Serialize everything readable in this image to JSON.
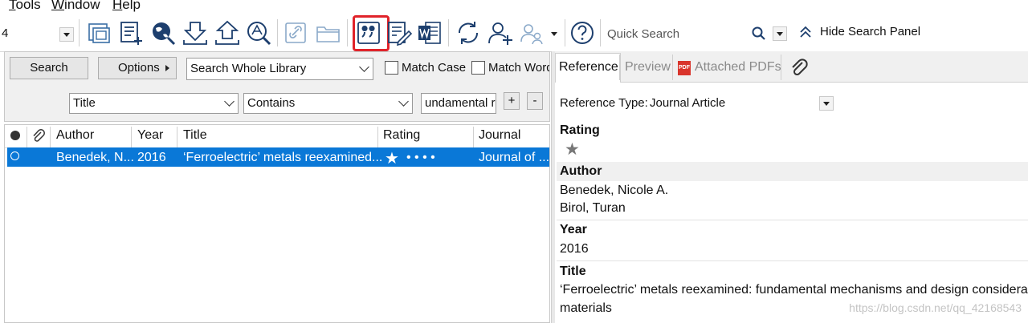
{
  "menubar": {
    "items": [
      {
        "label": "Tools",
        "underline": "T",
        "rest": "ools"
      },
      {
        "label": "Window",
        "underline": "W",
        "rest": "indow"
      },
      {
        "label": "Help",
        "underline": "H",
        "rest": "elp"
      }
    ]
  },
  "toolbar": {
    "style_value": "4",
    "icons": [
      "new-group-icon",
      "new-reference-icon",
      "online-search-icon",
      "import-icon",
      "export-icon",
      "find-full-text-icon",
      "open-link-icon",
      "open-file-icon",
      "insert-citation-icon",
      "format-paper-icon",
      "word-icon",
      "sync-icon",
      "share-library-icon",
      "groups-icon",
      "help-icon"
    ],
    "quick_search_placeholder": "Quick Search",
    "hide_search_panel_label": "Hide Search Panel",
    "highlight_color": "#e0232a"
  },
  "search_panel": {
    "search_button": "Search",
    "options_button": "Options",
    "scope_value": "Search Whole Library",
    "match_case_label": "Match Case",
    "match_words_label": "Match Words",
    "field_value": "Title",
    "operator_value": "Contains",
    "term_value": "undamental r",
    "add_button": "+",
    "remove_button": "-"
  },
  "library": {
    "columns": [
      "Author",
      "Year",
      "Title",
      "Rating",
      "Journal"
    ],
    "rows": [
      {
        "author": "Benedek, N...",
        "year": "2016",
        "title": "‘Ferroelectric’ metals reexamined...",
        "rating": 1,
        "rating_dots": "•  •  •  •",
        "journal": "Journal of ..."
      }
    ],
    "selected_color": "#0a78d7"
  },
  "reference_panel": {
    "tabs": [
      "Reference",
      "Preview",
      "Attached PDFs"
    ],
    "active_tab": "Reference",
    "reference_type_label": "Reference Type:",
    "reference_type_value": "Journal Article",
    "fields": {
      "rating_label": "Rating",
      "author_label": "Author",
      "authors": [
        "Benedek, Nicole A.",
        "Birol, Turan"
      ],
      "year_label": "Year",
      "year_value": "2016",
      "title_label": "Title",
      "title_line1": "‘Ferroelectric’ metals reexamined: fundamental mechanisms and design consideratic",
      "title_line2": "materials"
    }
  },
  "watermark": "https://blog.csdn.net/qq_42168543"
}
